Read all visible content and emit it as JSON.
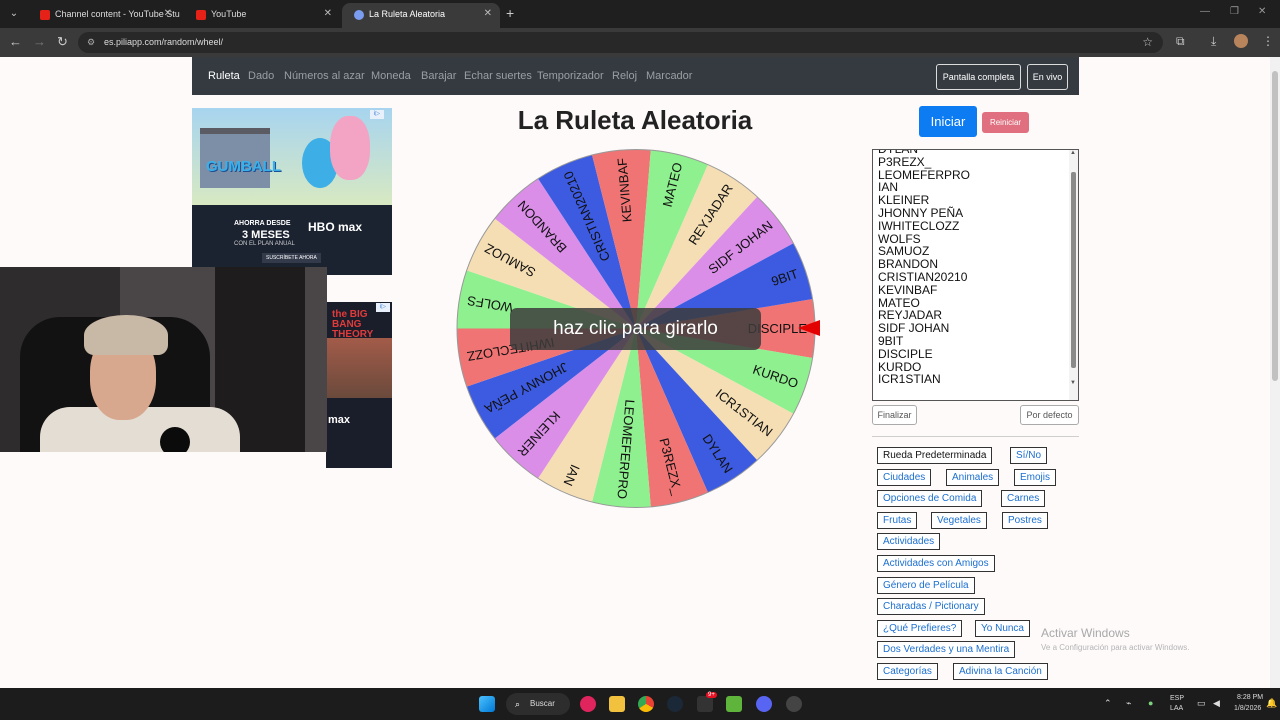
{
  "browser": {
    "tabs": [
      {
        "title": "Channel content - YouTube Stu",
        "color": "#e62117"
      },
      {
        "title": "YouTube",
        "color": "#e62117"
      },
      {
        "title": "La Ruleta Aleatoria",
        "color": "#7a9df0"
      }
    ],
    "url": "es.piliapp.com/random/wheel/"
  },
  "site_nav": {
    "items": [
      "Ruleta",
      "Dado",
      "Números al azar",
      "Moneda",
      "Barajar",
      "Echar suertes",
      "Temporizador",
      "Reloj",
      "Marcador"
    ],
    "fullscreen_label": "Pantalla completa",
    "live_label": "En vivo"
  },
  "ads": {
    "ad1_line1": "AHORRA DESDE",
    "ad1_line2": "3 MESES",
    "ad1_line3": "CON EL PLAN ANUAL",
    "ad1_brand": "HBO max",
    "ad1_cta": "SUSCRÍBETE AHORA",
    "ad1_show": "GUMBALL",
    "ad2_show": "the BIG BANG THEORY",
    "ad2_brand": "max"
  },
  "main": {
    "title": "La Ruleta Aleatoria",
    "spin_hint": "haz clic para girarlo",
    "start_label": "Iniciar",
    "reset_label": "Reiniciar"
  },
  "wheel": {
    "segments": [
      {
        "label": "DISCIPLE",
        "color": "#f07474"
      },
      {
        "label": "KURDO",
        "color": "#8ef08e"
      },
      {
        "label": "ICR1STIAN",
        "color": "#f5deb3"
      },
      {
        "label": "DYLAN",
        "color": "#3d5be0"
      },
      {
        "label": "P3REZX_",
        "color": "#f07474"
      },
      {
        "label": "LEOMEFERPRO",
        "color": "#8ef08e"
      },
      {
        "label": "IAN",
        "color": "#f5deb3"
      },
      {
        "label": "KLEINER",
        "color": "#da8ee8"
      },
      {
        "label": "JHONNY PEÑA",
        "color": "#3d5be0"
      },
      {
        "label": "IWHITECLOZZ",
        "color": "#f07474"
      },
      {
        "label": "WOLFS",
        "color": "#8ef08e"
      },
      {
        "label": "SAMUOZ",
        "color": "#f5deb3"
      },
      {
        "label": "BRANDON",
        "color": "#da8ee8"
      },
      {
        "label": "CRISTIAN20210",
        "color": "#3d5be0"
      },
      {
        "label": "KEVINBAF",
        "color": "#f07474"
      },
      {
        "label": "MATEO",
        "color": "#8ef08e"
      },
      {
        "label": "REYJADAR",
        "color": "#f5deb3"
      },
      {
        "label": "SIDF JOHAN",
        "color": "#da8ee8"
      },
      {
        "label": "9BIT",
        "color": "#3d5be0"
      }
    ]
  },
  "names_textarea": {
    "lines": [
      "DYLAN",
      "P3REZX_",
      "LEOMEFERPRO",
      "IAN",
      "KLEINER",
      "JHONNY PEÑA",
      "IWHITECLOZZ",
      "WOLFS",
      "SAMUOZ",
      "BRANDON",
      "CRISTIAN20210",
      "KEVINBAF",
      "MATEO",
      "REYJADAR",
      "SIDF JOHAN",
      "9BIT",
      "DISCIPLE",
      "KURDO",
      "ICR1STIAN"
    ]
  },
  "list_buttons": {
    "finalize": "Finalizar",
    "default": "Por defecto"
  },
  "presets": [
    "Rueda Predeterminada",
    "Sí/No",
    "Ciudades",
    "Animales",
    "Emojis",
    "Opciones de Comida",
    "Carnes",
    "Frutas",
    "Vegetales",
    "Postres",
    "Actividades",
    "Actividades con Amigos",
    "Género de Película",
    "Charadas / Pictionary",
    "¿Qué Prefieres?",
    "Yo Nunca",
    "Dos Verdades y una Mentira",
    "Categorías",
    "Adivina la Canción"
  ],
  "watermark": {
    "line1": "Activar Windows",
    "line2": "Ve a Configuración para activar Windows."
  },
  "taskbar": {
    "search_label": "Buscar",
    "lang1": "ESP",
    "lang2": "LAA",
    "time": "8:28 PM",
    "date": "1/8/2026",
    "badge": "9+"
  }
}
